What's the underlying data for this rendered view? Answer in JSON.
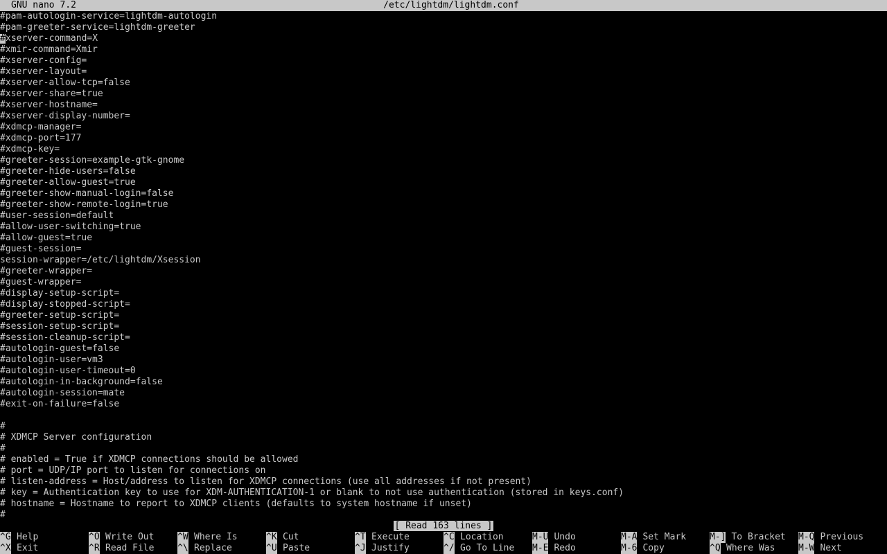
{
  "titlebar": {
    "app": "GNU nano 7.2",
    "file": "/etc/lightdm/lightdm.conf"
  },
  "editor": {
    "lines": [
      "#pam-autologin-service=lightdm-autologin",
      "#pam-greeter-service=lightdm-greeter",
      "#xserver-command=X",
      "#xmir-command=Xmir",
      "#xserver-config=",
      "#xserver-layout=",
      "#xserver-allow-tcp=false",
      "#xserver-share=true",
      "#xserver-hostname=",
      "#xserver-display-number=",
      "#xdmcp-manager=",
      "#xdmcp-port=177",
      "#xdmcp-key=",
      "#greeter-session=example-gtk-gnome",
      "#greeter-hide-users=false",
      "#greeter-allow-guest=true",
      "#greeter-show-manual-login=false",
      "#greeter-show-remote-login=true",
      "#user-session=default",
      "#allow-user-switching=true",
      "#allow-guest=true",
      "#guest-session=",
      "session-wrapper=/etc/lightdm/Xsession",
      "#greeter-wrapper=",
      "#guest-wrapper=",
      "#display-setup-script=",
      "#display-stopped-script=",
      "#greeter-setup-script=",
      "#session-setup-script=",
      "#session-cleanup-script=",
      "#autologin-guest=false",
      "#autologin-user=vm3",
      "#autologin-user-timeout=0",
      "#autologin-in-background=false",
      "#autologin-session=mate",
      "#exit-on-failure=false",
      "",
      "#",
      "# XDMCP Server configuration",
      "#",
      "# enabled = True if XDMCP connections should be allowed",
      "# port = UDP/IP port to listen for connections on",
      "# listen-address = Host/address to listen for XDMCP connections (use all addresses if not present)",
      "# key = Authentication key to use for XDM-AUTHENTICATION-1 or blank to not use authentication (stored in keys.conf)",
      "# hostname = Hostname to report to XDMCP clients (defaults to system hostname if unset)",
      "#"
    ]
  },
  "status": {
    "message": "[ Read 163 lines ]"
  },
  "shortcuts": {
    "row1": [
      {
        "key": "^G",
        "label": "Help",
        "name": "help"
      },
      {
        "key": "^O",
        "label": "Write Out",
        "name": "write-out"
      },
      {
        "key": "^W",
        "label": "Where Is",
        "name": "where-is"
      },
      {
        "key": "^K",
        "label": "Cut",
        "name": "cut"
      },
      {
        "key": "^T",
        "label": "Execute",
        "name": "execute"
      },
      {
        "key": "^C",
        "label": "Location",
        "name": "location"
      },
      {
        "key": "M-U",
        "label": "Undo",
        "name": "undo"
      },
      {
        "key": "M-A",
        "label": "Set Mark",
        "name": "set-mark"
      },
      {
        "key": "M-]",
        "label": "To Bracket",
        "name": "to-bracket"
      },
      {
        "key": "M-Q",
        "label": "Previous",
        "name": "previous"
      }
    ],
    "row2": [
      {
        "key": "^X",
        "label": "Exit",
        "name": "exit"
      },
      {
        "key": "^R",
        "label": "Read File",
        "name": "read-file"
      },
      {
        "key": "^\\",
        "label": "Replace",
        "name": "replace"
      },
      {
        "key": "^U",
        "label": "Paste",
        "name": "paste"
      },
      {
        "key": "^J",
        "label": "Justify",
        "name": "justify"
      },
      {
        "key": "^/",
        "label": "Go To Line",
        "name": "go-to-line"
      },
      {
        "key": "M-E",
        "label": "Redo",
        "name": "redo"
      },
      {
        "key": "M-6",
        "label": "Copy",
        "name": "copy"
      },
      {
        "key": "^Q",
        "label": "Where Was",
        "name": "where-was"
      },
      {
        "key": "M-W",
        "label": "Next",
        "name": "next"
      }
    ]
  }
}
